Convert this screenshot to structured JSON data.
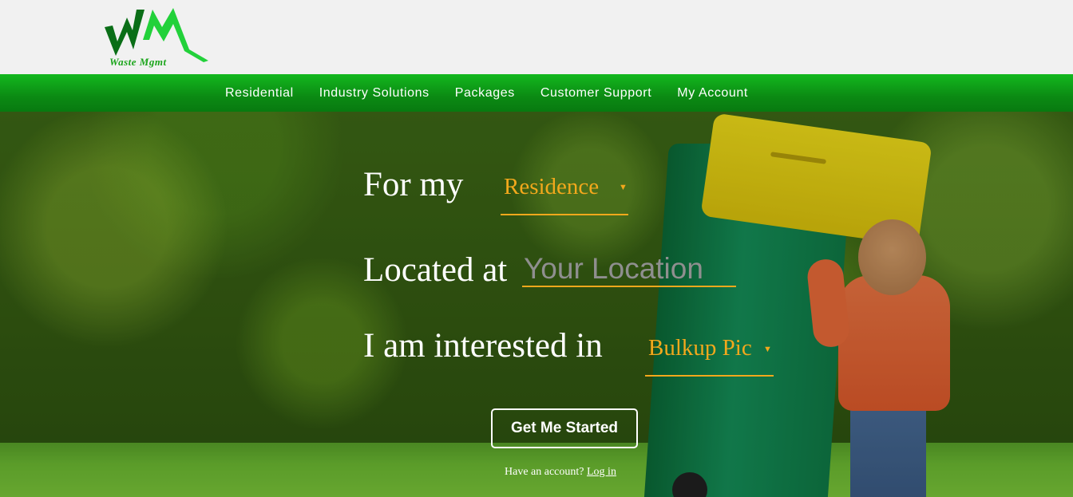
{
  "logo": {
    "initials": "WM",
    "text": "Waste Mgmt"
  },
  "nav": {
    "items": [
      "Residential",
      "Industry Solutions",
      "Packages",
      "Customer Support",
      "My Account"
    ]
  },
  "form": {
    "for_my_label": "For my",
    "for_my_value": "Residence",
    "located_label": "Located at",
    "location_placeholder": "Your Location",
    "interest_label": "I am interested in",
    "interest_value": "Bulkup Pic",
    "submit_label": "Get Me Started",
    "login_prompt": "Have an account?",
    "login_link": "Log in"
  },
  "colors": {
    "nav_green": "#0b8a13",
    "accent_orange": "#f2a81c",
    "logo_dark_green": "#0a6e17",
    "logo_light_green": "#22d13a"
  }
}
